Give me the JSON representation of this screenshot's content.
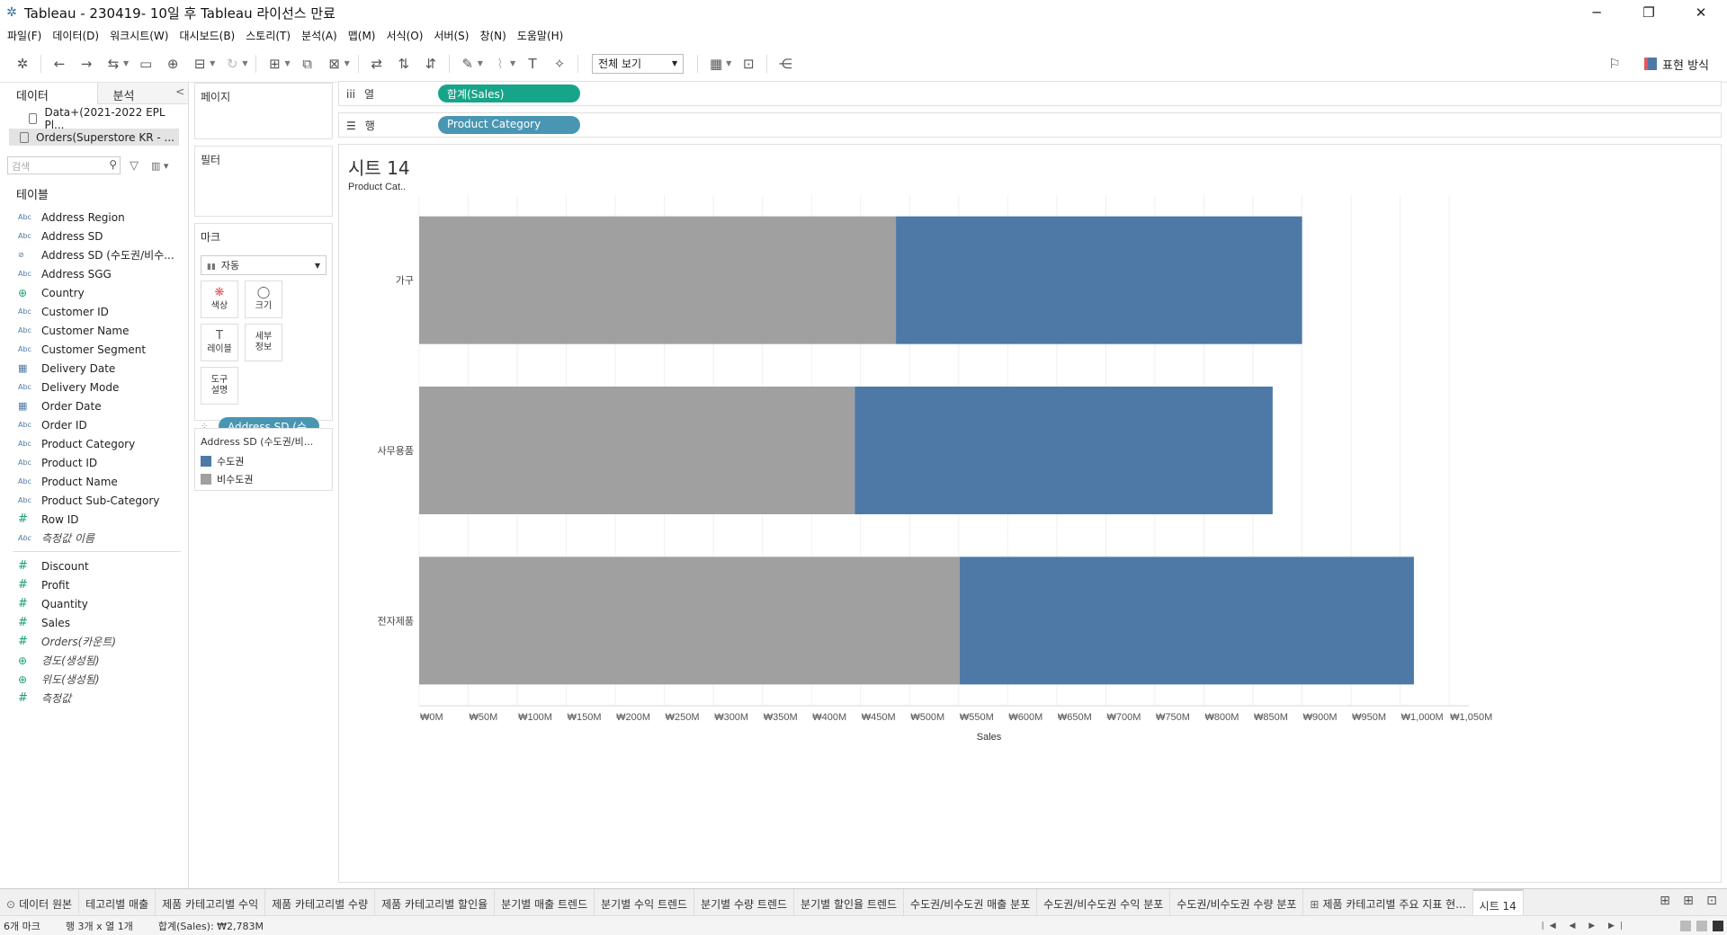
{
  "window": {
    "title": "Tableau - 230419- 10일 후 Tableau 라이선스 만료",
    "minimize": "─",
    "restore": "❐",
    "close": "✕"
  },
  "menu": [
    "파일(F)",
    "데이터(D)",
    "워크시트(W)",
    "대시보드(B)",
    "스토리(T)",
    "분석(A)",
    "맵(M)",
    "서식(O)",
    "서버(S)",
    "창(N)",
    "도움말(H)"
  ],
  "toolbar": {
    "view_select": "전체 보기",
    "show_me": "표현 방식"
  },
  "data_pane": {
    "tab_data": "데이터",
    "tab_analysis": "분석",
    "collapse": "<",
    "datasources": [
      "Data+(2021-2022 EPL Pl...",
      "Orders(Superstore KR - ..."
    ],
    "search_placeholder": "검색",
    "tables_title": "테이블",
    "dimensions": [
      {
        "type": "Abc",
        "name": "Address Region"
      },
      {
        "type": "Abc",
        "name": "Address SD"
      },
      {
        "type": "⊘",
        "name": "Address SD (수도권/비수..."
      },
      {
        "type": "Abc",
        "name": "Address SGG"
      },
      {
        "type": "⊕",
        "name": "Country"
      },
      {
        "type": "Abc",
        "name": "Customer ID"
      },
      {
        "type": "Abc",
        "name": "Customer Name"
      },
      {
        "type": "Abc",
        "name": "Customer Segment"
      },
      {
        "type": "▦",
        "name": "Delivery Date"
      },
      {
        "type": "Abc",
        "name": "Delivery Mode"
      },
      {
        "type": "▦",
        "name": "Order Date"
      },
      {
        "type": "Abc",
        "name": "Order ID"
      },
      {
        "type": "Abc",
        "name": "Product Category"
      },
      {
        "type": "Abc",
        "name": "Product ID"
      },
      {
        "type": "Abc",
        "name": "Product Name"
      },
      {
        "type": "Abc",
        "name": "Product Sub-Category"
      },
      {
        "type": "#",
        "name": "Row ID"
      },
      {
        "type": "Abc",
        "name": "측정값 이름"
      }
    ],
    "measures": [
      {
        "type": "#",
        "name": "Discount"
      },
      {
        "type": "#",
        "name": "Profit"
      },
      {
        "type": "#",
        "name": "Quantity"
      },
      {
        "type": "#",
        "name": "Sales"
      },
      {
        "type": "#",
        "name": "Orders(카운트)"
      },
      {
        "type": "⊕",
        "name": "경도(생성됨)"
      },
      {
        "type": "⊕",
        "name": "위도(생성됨)"
      },
      {
        "type": "#",
        "name": "측정값"
      }
    ]
  },
  "cards": {
    "pages_title": "페이지",
    "filters_title": "필터",
    "marks_title": "마크",
    "mark_type": "자동",
    "buttons": [
      {
        "label": "색상",
        "icon": "❋"
      },
      {
        "label": "크기",
        "icon": "◯"
      },
      {
        "label": "레이블",
        "icon": "T"
      },
      {
        "label": "세부\n정보",
        "icon": ""
      },
      {
        "label": "도구\n설명",
        "icon": ""
      }
    ],
    "color_pill": "Address SD (수...",
    "legend_title": "Address SD (수도권/비...",
    "legend_items": [
      {
        "label": "수도권",
        "color": "#4e79a7"
      },
      {
        "label": "비수도권",
        "color": "#a0a0a0"
      }
    ]
  },
  "shelves": {
    "columns_label": "열",
    "columns_pill": "합계(Sales)",
    "rows_label": "행",
    "rows_pill": "Product Category"
  },
  "sheet_title": "시트 14",
  "chart_data": {
    "type": "bar",
    "orientation": "horizontal",
    "stacked": true,
    "row_header": "Product Cat..",
    "categories": [
      "가구",
      "사무용품",
      "전자제품"
    ],
    "series": [
      {
        "name": "비수도권",
        "color": "#a0a0a0",
        "values": [
          486,
          444,
          551
        ]
      },
      {
        "name": "수도권",
        "color": "#4e79a7",
        "values": [
          414,
          426,
          463
        ]
      }
    ],
    "xlabel": "Sales",
    "xlim": [
      0,
      1070
    ],
    "x_ticks": [
      {
        "value": 0,
        "label": "₩0M"
      },
      {
        "value": 50,
        "label": "₩50M"
      },
      {
        "value": 100,
        "label": "₩100M"
      },
      {
        "value": 150,
        "label": "₩150M"
      },
      {
        "value": 200,
        "label": "₩200M"
      },
      {
        "value": 250,
        "label": "₩250M"
      },
      {
        "value": 300,
        "label": "₩300M"
      },
      {
        "value": 350,
        "label": "₩350M"
      },
      {
        "value": 400,
        "label": "₩400M"
      },
      {
        "value": 450,
        "label": "₩450M"
      },
      {
        "value": 500,
        "label": "₩500M"
      },
      {
        "value": 550,
        "label": "₩550M"
      },
      {
        "value": 600,
        "label": "₩600M"
      },
      {
        "value": 650,
        "label": "₩650M"
      },
      {
        "value": 700,
        "label": "₩700M"
      },
      {
        "value": 750,
        "label": "₩750M"
      },
      {
        "value": 800,
        "label": "₩800M"
      },
      {
        "value": 850,
        "label": "₩850M"
      },
      {
        "value": 900,
        "label": "₩900M"
      },
      {
        "value": 950,
        "label": "₩950M"
      },
      {
        "value": 1000,
        "label": "₩1,000M"
      },
      {
        "value": 1050,
        "label": "₩1,050M"
      }
    ],
    "grid": true
  },
  "bottom_tabs": [
    {
      "label": "데이터 원본",
      "icon": "⊙"
    },
    {
      "label": "테고리별 매출",
      "icon": ""
    },
    {
      "label": "제품 카테고리별 수익",
      "icon": ""
    },
    {
      "label": "제품 카테고리별 수량",
      "icon": ""
    },
    {
      "label": "제품 카테고리별 할인율",
      "icon": ""
    },
    {
      "label": "분기별 매출 트렌드",
      "icon": ""
    },
    {
      "label": "분기별 수익 트렌드",
      "icon": ""
    },
    {
      "label": "분기별 수량 트렌드",
      "icon": ""
    },
    {
      "label": "분기별 할인율 트렌드",
      "icon": ""
    },
    {
      "label": "수도권/비수도권 매출 분포",
      "icon": ""
    },
    {
      "label": "수도권/비수도권 수익 분포",
      "icon": ""
    },
    {
      "label": "수도권/비수도권 수량 분포",
      "icon": ""
    },
    {
      "label": "제품 카테고리별 주요 지표 현...",
      "icon": "⊞"
    },
    {
      "label": "시트 14",
      "icon": "",
      "active": true
    }
  ],
  "status": {
    "marks": "6개 마크",
    "rows_cols": "행 3개 x 열 1개",
    "sum": "합계(Sales): ₩2,783M"
  }
}
